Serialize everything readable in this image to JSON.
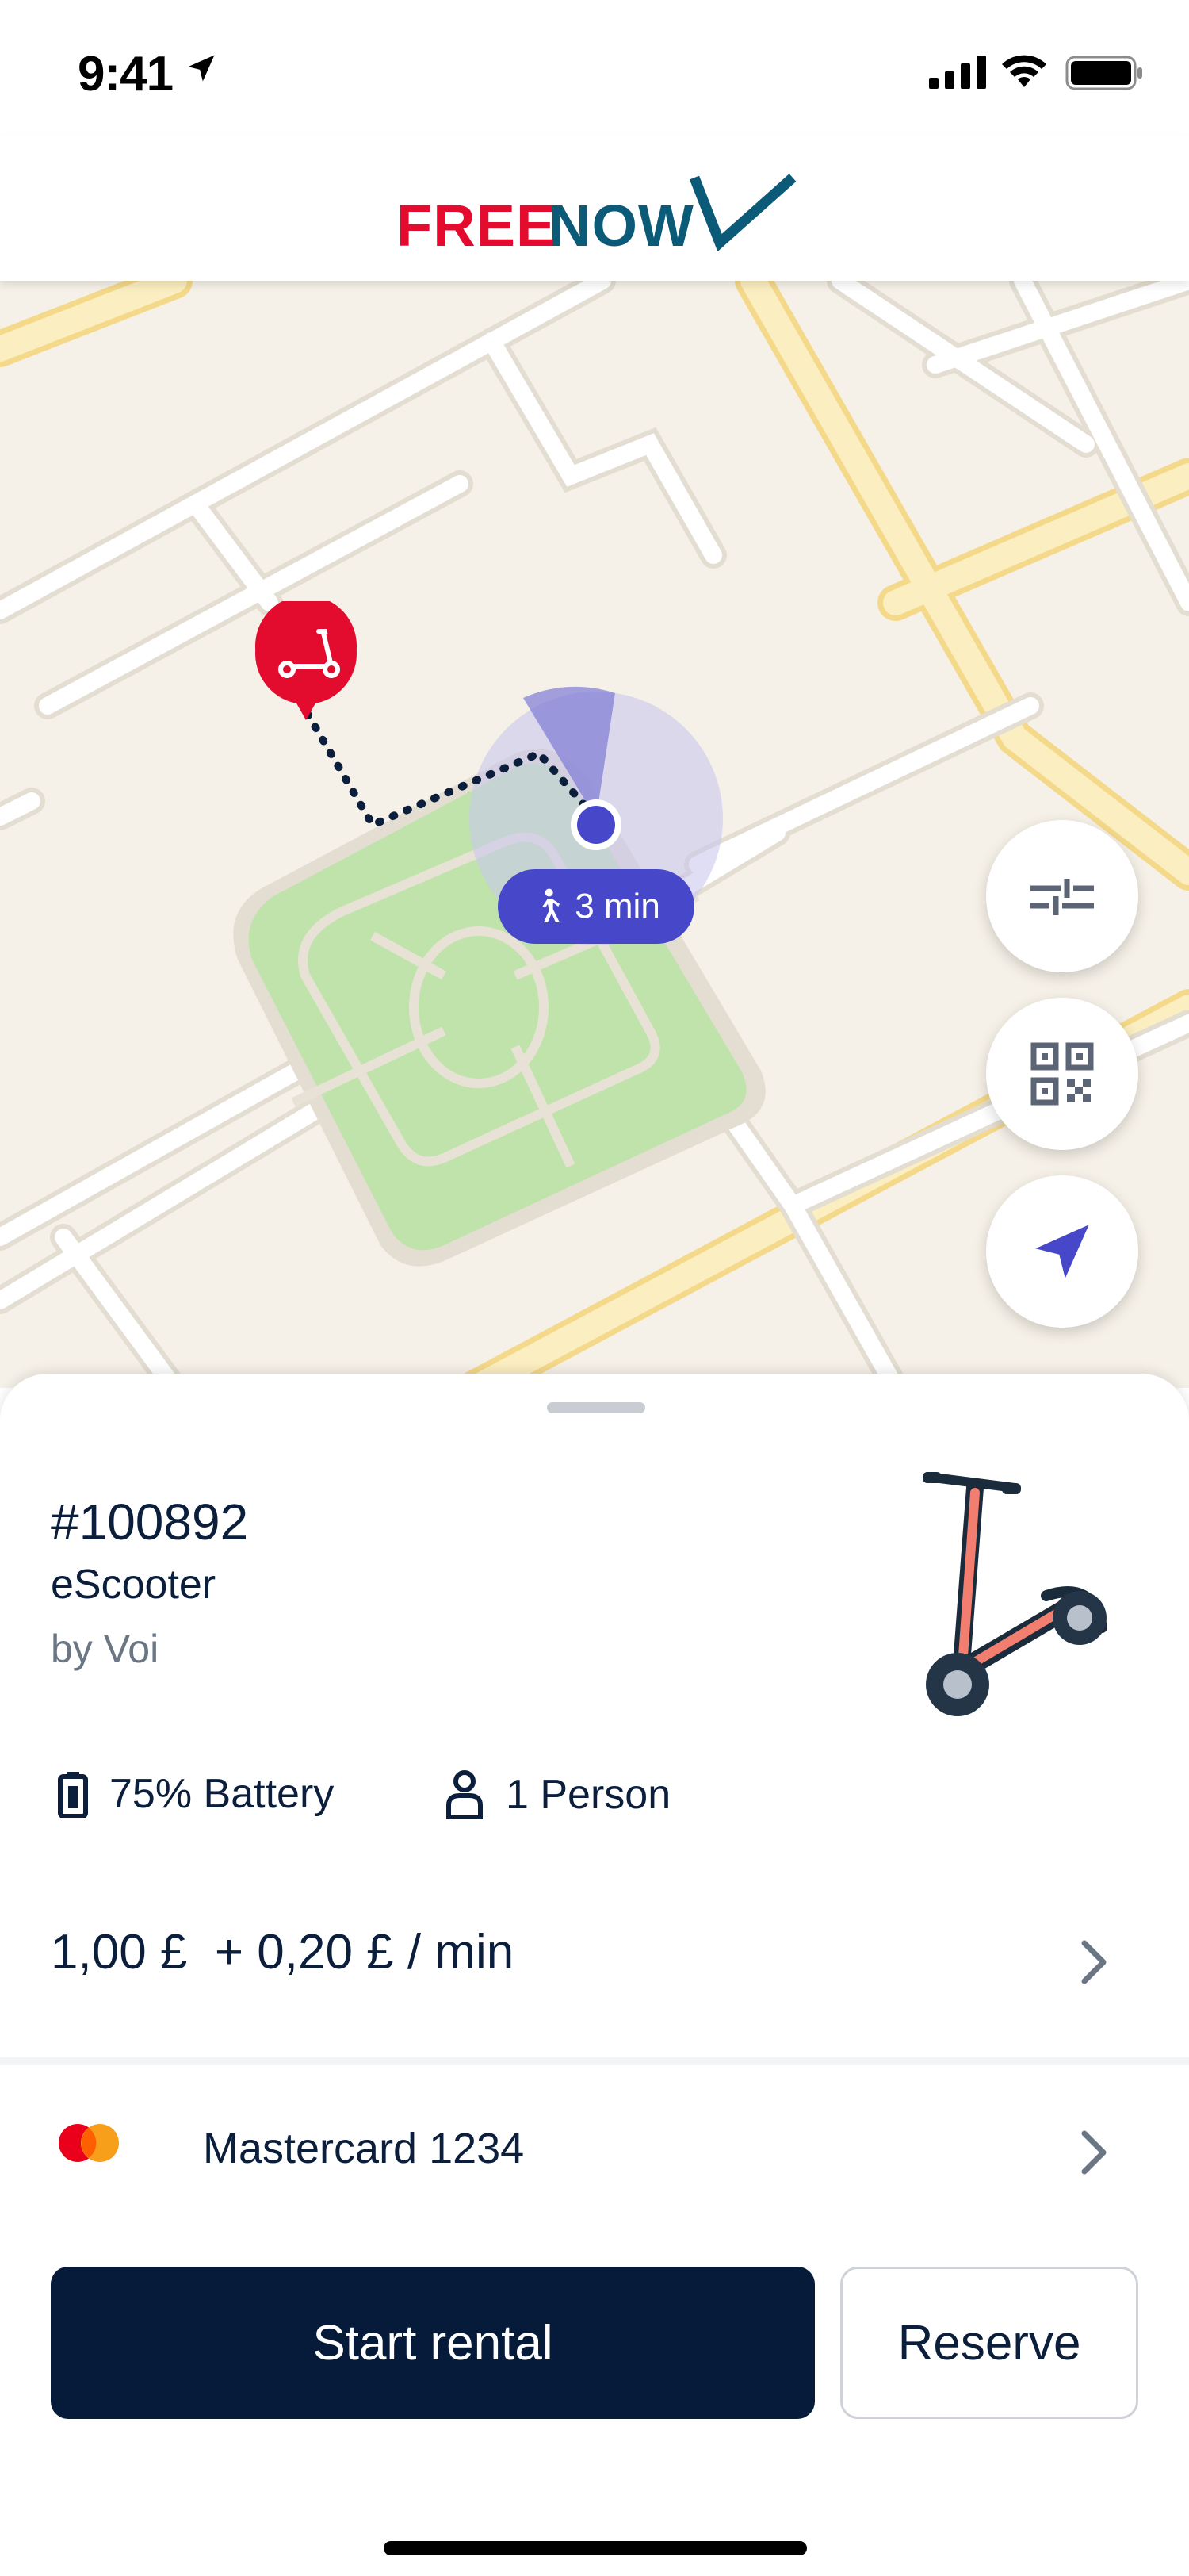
{
  "status_bar": {
    "time": "9:41",
    "icons": [
      "location-arrow-icon",
      "cellular-signal-icon",
      "wifi-icon",
      "battery-icon"
    ]
  },
  "header": {
    "logo_free": "FREE",
    "logo_now": "NOW"
  },
  "map": {
    "walk_time": "3 min",
    "markers": [
      "scooter-pin-icon",
      "user-location-dot"
    ],
    "buttons": [
      "filter-sliders-icon",
      "qr-code-icon",
      "navigation-arrow-icon"
    ]
  },
  "vehicle": {
    "id": "#100892",
    "type": "eScooter",
    "provider": "by Voi",
    "battery": "75% Battery",
    "capacity": "1 Person",
    "price": "1,00 £  + 0,20 £ / min"
  },
  "payment": {
    "method": "Mastercard 1234"
  },
  "actions": {
    "start": "Start rental",
    "reserve": "Reserve"
  },
  "colors": {
    "brand_red": "#e30b2e",
    "brand_teal": "#0b5a77",
    "accent_purple": "#4747c9",
    "primary_navy": "#061b3a",
    "map_bg": "#f6f1e8",
    "park_green": "#bfe3ab"
  }
}
